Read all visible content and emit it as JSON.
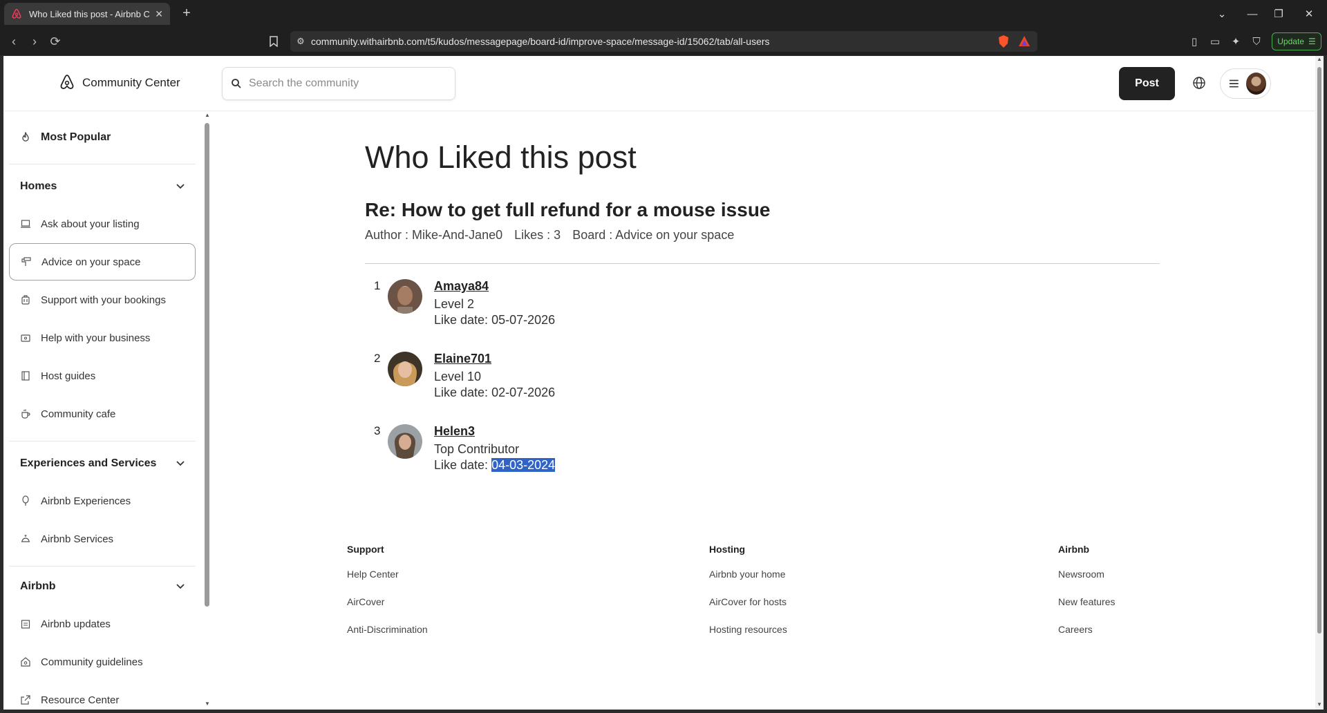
{
  "browser": {
    "tab_title": "Who Liked this post - Airbnb Co",
    "new_tab": "+",
    "url": "community.withairbnb.com/t5/kudos/messagepage/board-id/improve-space/message-id/15062/tab/all-users",
    "update_label": "Update"
  },
  "header": {
    "brand": "Community Center",
    "search_placeholder": "Search the community",
    "post_label": "Post"
  },
  "sidebar": {
    "most_popular": "Most Popular",
    "homes": {
      "title": "Homes",
      "items": [
        "Ask about your listing",
        "Advice on your space",
        "Support with your bookings",
        "Help with your business",
        "Host guides",
        "Community cafe"
      ]
    },
    "experiences": {
      "title": "Experiences and Services",
      "items": [
        "Airbnb Experiences",
        "Airbnb Services"
      ]
    },
    "airbnb": {
      "title": "Airbnb",
      "items": [
        "Airbnb updates",
        "Community guidelines",
        "Resource Center"
      ]
    }
  },
  "main": {
    "page_title": "Who Liked this post",
    "post_title": "Re: How to get full refund for a mouse issue",
    "author": "Author : Mike-And-Jane0",
    "likes": "Likes : 3",
    "board": "Board : Advice on your space",
    "likers": [
      {
        "index": "1",
        "name": "Amaya84",
        "level": "Level 2",
        "date_label": "Like date:",
        "date": "05-07-2026"
      },
      {
        "index": "2",
        "name": "Elaine701",
        "level": "Level 10",
        "date_label": "Like date:",
        "date": "02-07-2026"
      },
      {
        "index": "3",
        "name": "Helen3",
        "level": "Top Contributor",
        "date_label": "Like date:",
        "date": "04-03-2024"
      }
    ]
  },
  "footer": {
    "support": {
      "title": "Support",
      "links": [
        "Help Center",
        "AirCover",
        "Anti-Discrimination"
      ]
    },
    "hosting": {
      "title": "Hosting",
      "links": [
        "Airbnb your home",
        "AirCover for hosts",
        "Hosting resources"
      ]
    },
    "airbnb": {
      "title": "Airbnb",
      "links": [
        "Newsroom",
        "New features",
        "Careers"
      ]
    }
  },
  "colors": {
    "brand_red": "#ff385c",
    "selection": "#2f63c8",
    "post_button": "#222222"
  }
}
